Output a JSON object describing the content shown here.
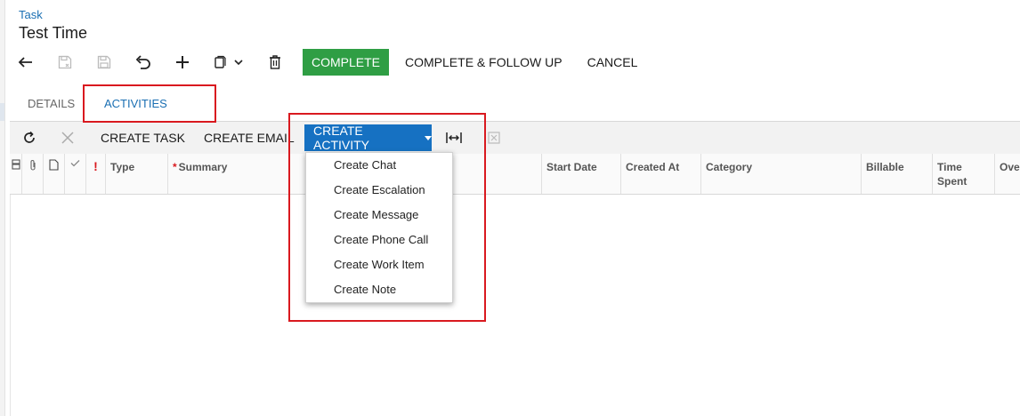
{
  "breadcrumb": "Task",
  "page_title": "Test Time",
  "toolbar": {
    "icons": [
      "back-icon",
      "save-close-icon",
      "save-icon",
      "undo-icon",
      "add-icon",
      "copy-paste-icon",
      "delete-icon"
    ],
    "complete_label": "COMPLETE",
    "complete_follow_up_label": "COMPLETE & FOLLOW UP",
    "cancel_label": "CANCEL"
  },
  "tabs": [
    {
      "label": "DETAILS",
      "active": false
    },
    {
      "label": "ACTIVITIES",
      "active": true
    }
  ],
  "grid_toolbar": {
    "create_task_label": "CREATE TASK",
    "create_email_label": "CREATE EMAIL",
    "create_activity_label": "CREATE ACTIVITY"
  },
  "grid_columns": {
    "type": "Type",
    "summary": "Summary",
    "start_date": "Start Date",
    "created_at": "Created At",
    "category": "Category",
    "billable": "Billable",
    "time_spent": "Time Spent",
    "overtime": "Ove",
    "priority_mark": "!"
  },
  "dropdown_items": [
    "Create Chat",
    "Create Escalation",
    "Create Message",
    "Create Phone Call",
    "Create Work Item",
    "Create Note"
  ],
  "colors": {
    "accent": "#1671c2",
    "complete": "#2f9e44",
    "highlight": "#d9191f",
    "link": "#1a6fb3"
  }
}
